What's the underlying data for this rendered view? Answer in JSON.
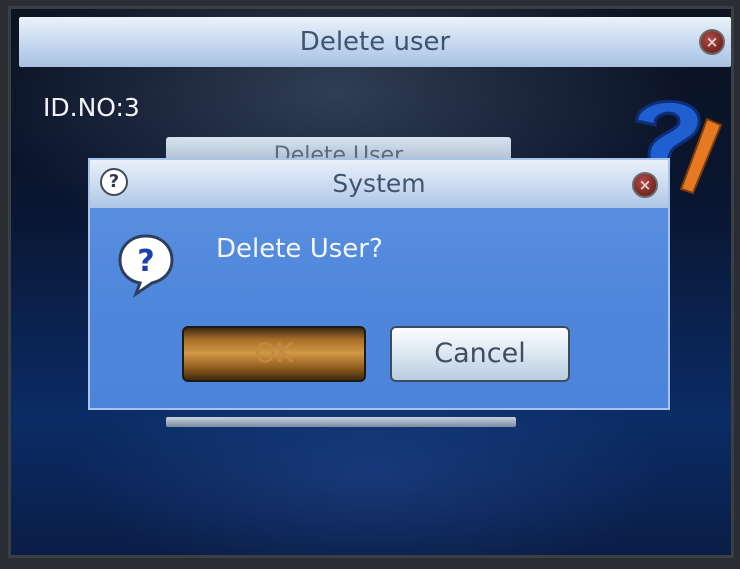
{
  "screen": {
    "title": "Delete user",
    "id_label": "ID.NO:3",
    "background_button_label": "Delete User"
  },
  "dialog": {
    "title": "System",
    "message": "Delete User?",
    "ok_label": "OK",
    "cancel_label": "Cancel"
  },
  "icons": {
    "close": "close-icon",
    "help": "help-icon",
    "question": "question-icon"
  },
  "colors": {
    "dialog_bg": "#4f87dc",
    "ok_button": "#d29846",
    "cancel_button": "#dfe9f3",
    "close_button": "#7c2b28"
  }
}
